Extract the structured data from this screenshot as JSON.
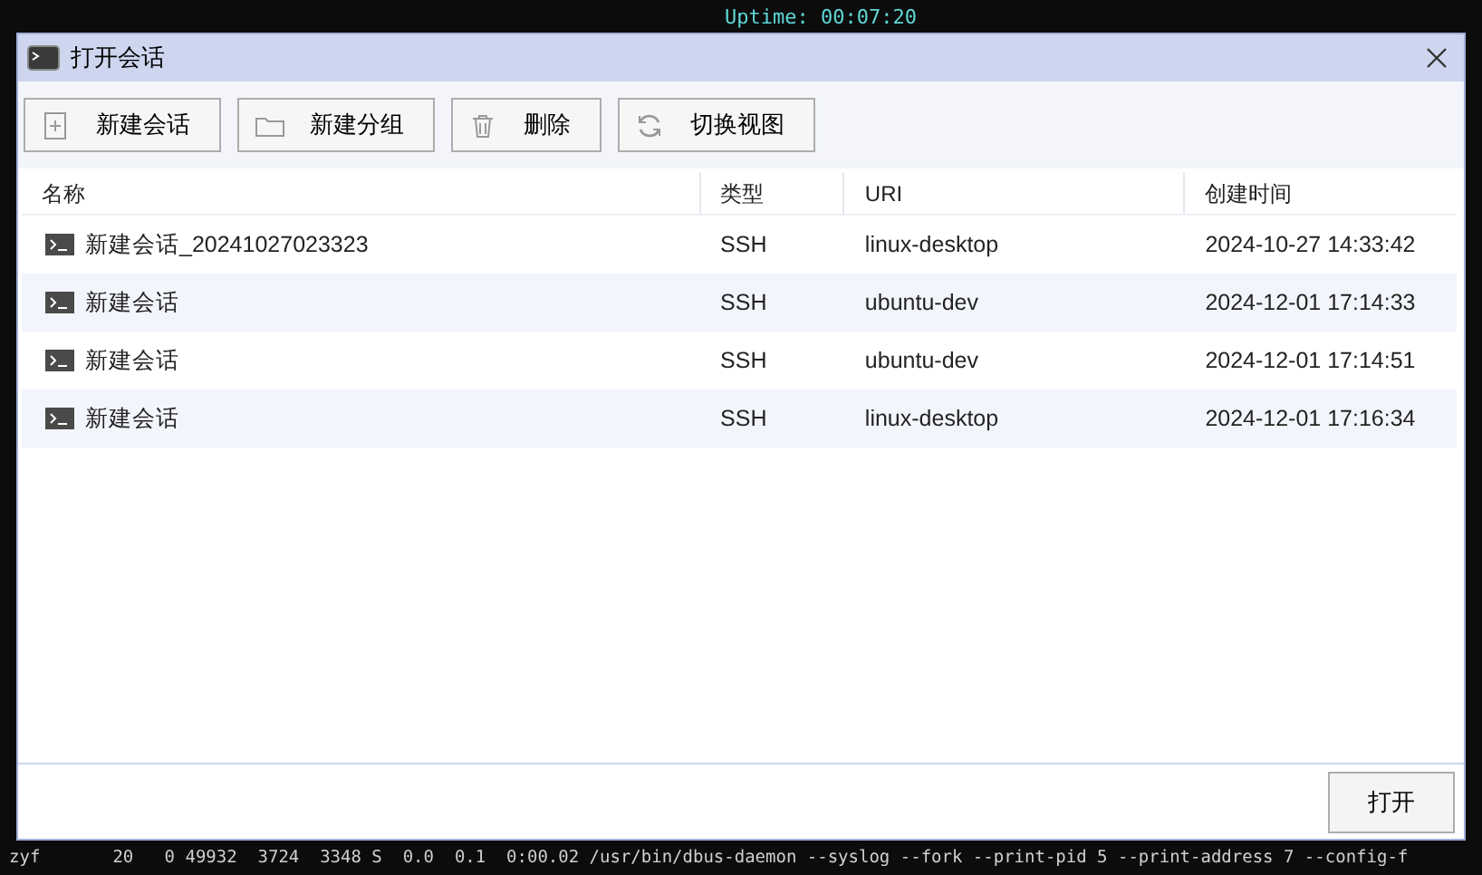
{
  "terminal": {
    "top_line": "Uptime: 00:07:20",
    "bottom_line": "zyf       20   0 49932  3724  3348 S  0.0  0.1  0:00.02 /usr/bin/dbus-daemon --syslog --fork --print-pid 5 --print-address 7 --config-f"
  },
  "window": {
    "title": "打开会话"
  },
  "toolbar": [
    {
      "kind": "new-session",
      "label": "新建会话"
    },
    {
      "kind": "new-group",
      "label": "新建分组"
    },
    {
      "kind": "delete",
      "label": "删除"
    },
    {
      "kind": "switch-view",
      "label": "切换视图"
    }
  ],
  "table": {
    "columns": [
      "名称",
      "类型",
      "URI",
      "创建时间"
    ],
    "rows": [
      {
        "name": "新建会话_20241027023323",
        "type": "SSH",
        "uri": "linux-desktop",
        "created": "2024-10-27 14:33:42"
      },
      {
        "name": "新建会话",
        "type": "SSH",
        "uri": "ubuntu-dev",
        "created": "2024-12-01 17:14:33"
      },
      {
        "name": "新建会话",
        "type": "SSH",
        "uri": "ubuntu-dev",
        "created": "2024-12-01 17:14:51"
      },
      {
        "name": "新建会话",
        "type": "SSH",
        "uri": "linux-desktop",
        "created": "2024-12-01 17:16:34"
      }
    ]
  },
  "footer": {
    "open_button": "打开"
  }
}
